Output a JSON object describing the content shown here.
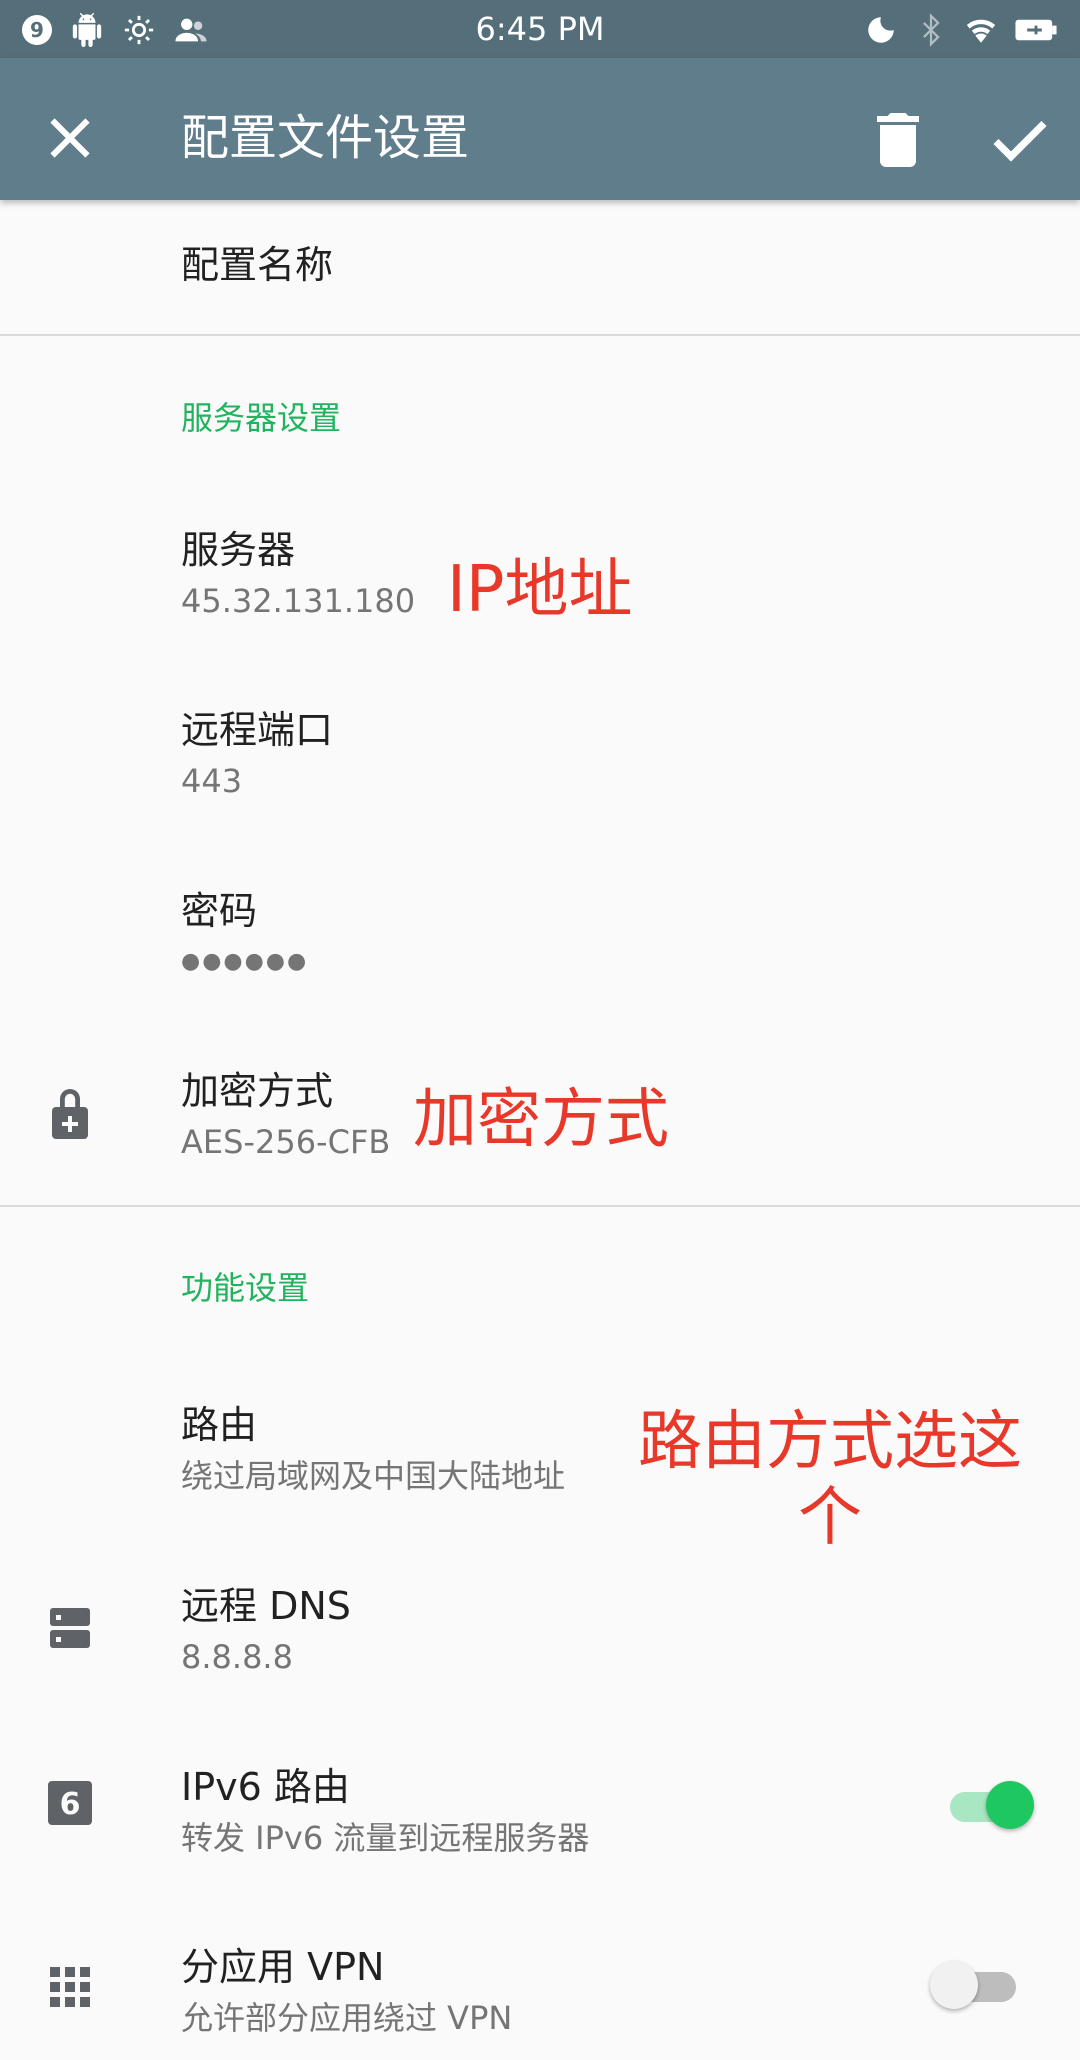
{
  "status_bar": {
    "time": "6:45 PM",
    "notification_badge": "9",
    "left_icons": [
      "android-icon",
      "brightness-icon",
      "contacts-icon"
    ],
    "right_icons": [
      "moon-icon",
      "bluetooth-icon",
      "wifi-icon",
      "battery-charging-icon"
    ]
  },
  "app_bar": {
    "title": "配置文件设置",
    "close_icon": "close-icon",
    "delete_icon": "trash-icon",
    "confirm_icon": "check-icon"
  },
  "profile_name": {
    "label": "配置名称"
  },
  "server_section": {
    "header": "服务器设置",
    "items": [
      {
        "title": "服务器",
        "value": "45.32.131.180"
      },
      {
        "title": "远程端口",
        "value": "443"
      },
      {
        "title": "密码",
        "value": "●●●●●●"
      },
      {
        "title": "加密方式",
        "value": "AES-256-CFB",
        "icon": "lock-plus-icon"
      }
    ]
  },
  "feature_section": {
    "header": "功能设置",
    "items": [
      {
        "title": "路由",
        "value": "绕过局域网及中国大陆地址"
      },
      {
        "title": "远程 DNS",
        "value": "8.8.8.8",
        "icon": "dns-server-icon"
      },
      {
        "title": "IPv6 路由",
        "value": "转发 IPv6 流量到远程服务器",
        "icon": "ipv6-icon",
        "toggle": true
      },
      {
        "title": "分应用 VPN",
        "value": "允许部分应用绕过 VPN",
        "icon": "apps-grid-icon",
        "toggle": false
      }
    ]
  },
  "annotations": {
    "ip": "IP地址",
    "encryption": "加密方式",
    "route_line1": "路由方式选这",
    "route_line2": "个"
  },
  "colors": {
    "app_bar": "#607d8b",
    "status_bar": "#546e7a",
    "section_header": "#22b35e",
    "annotation": "#e8382a",
    "toggle_on": "#1ec760"
  }
}
